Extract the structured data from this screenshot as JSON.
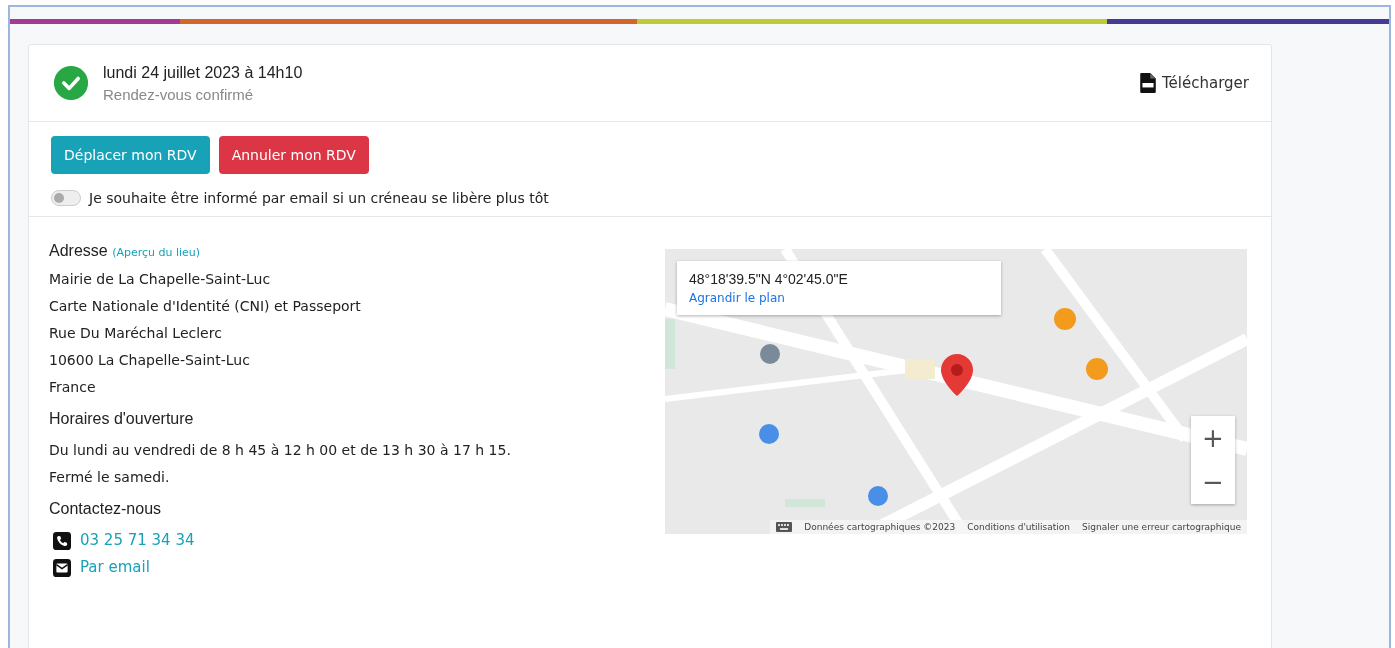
{
  "appointment": {
    "date": "lundi 24 juillet 2023 à 14h10",
    "status": "Rendez-vous confirmé",
    "confirmed": true
  },
  "download": {
    "label": "Télécharger"
  },
  "buttons": [
    {
      "label": "Déplacer mon RDV",
      "kind": "primary"
    },
    {
      "label": "Annuler mon RDV",
      "kind": "danger"
    }
  ],
  "notify": {
    "label": "Je souhaite être informé par email si un créneau se libère plus tôt",
    "on": false
  },
  "address": {
    "heading": "Adresse",
    "link": "(Aperçu du lieu)",
    "lines": [
      "Mairie de La Chapelle-Saint-Luc",
      "Carte Nationale d'Identité (CNI) et Passeport",
      "Rue Du Maréchal Leclerc",
      "10600 La Chapelle-Saint-Luc",
      "France"
    ]
  },
  "hours": {
    "heading": "Horaires d'ouverture",
    "lines": [
      "Du lundi au vendredi de 8 h 45 à 12 h 00 et de 13 h 30 à 17 h 15.",
      "Fermé le samedi."
    ]
  },
  "contact": {
    "heading": "Contactez-nous",
    "items": [
      {
        "kind": "phone",
        "label": "03 25 71 34 34"
      },
      {
        "kind": "email",
        "label": "Par email"
      }
    ]
  },
  "map": {
    "coordinates": "48°18'39.5\"N 4°02'45.0\"E",
    "enlarge": "Agrandir le plan",
    "zoom_in": "+",
    "zoom_out": "−",
    "attribution": [
      "Données cartographiques ©2023",
      "Conditions d'utilisation",
      "Signaler une erreur cartographique"
    ]
  }
}
